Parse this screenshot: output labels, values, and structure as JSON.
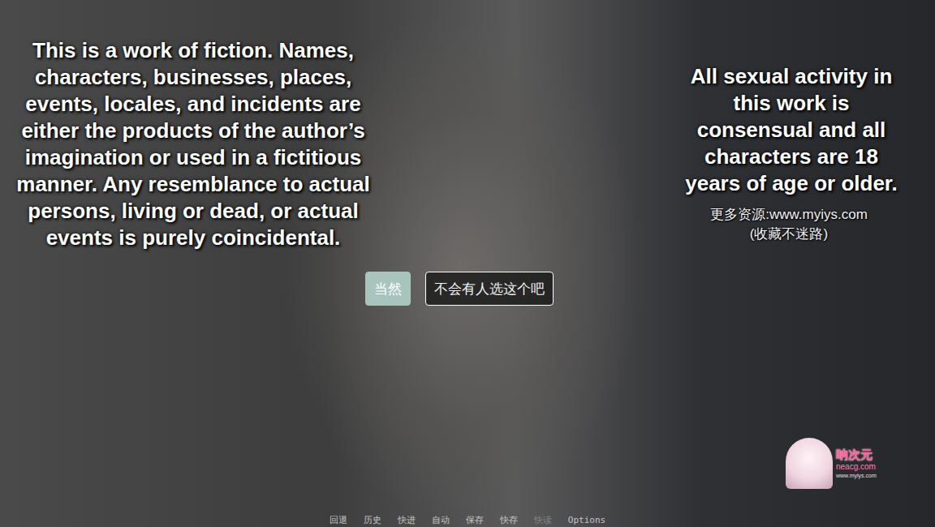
{
  "disclaimer": {
    "fiction": "This is a work of fiction. Names, characters, businesses, places, events, locales, and incidents are either the products of the author’s imagination or used in a fictitious manner. Any resemblance to actual persons, living or dead, or actual events is purely coincidental.",
    "consent": "All sexual activity in this work is consensual and all characters are 18 years of age or older."
  },
  "watermark": {
    "line1": "更多资源:www.myiys.com",
    "line2": "(收藏不迷路)"
  },
  "choices": [
    {
      "label": "当然",
      "selected": true
    },
    {
      "label": "不会有人选这个吧",
      "selected": false
    }
  ],
  "quick_menu": [
    {
      "label": "回退",
      "disabled": false
    },
    {
      "label": "历史",
      "disabled": false
    },
    {
      "label": "快进",
      "disabled": false
    },
    {
      "label": "自动",
      "disabled": false
    },
    {
      "label": "保存",
      "disabled": false
    },
    {
      "label": "快存",
      "disabled": false
    },
    {
      "label": "快读",
      "disabled": true
    },
    {
      "label": "Options",
      "disabled": false
    }
  ],
  "logo": {
    "name": "呐次元",
    "site": "neacg.com",
    "url": "www.myiys.com"
  }
}
